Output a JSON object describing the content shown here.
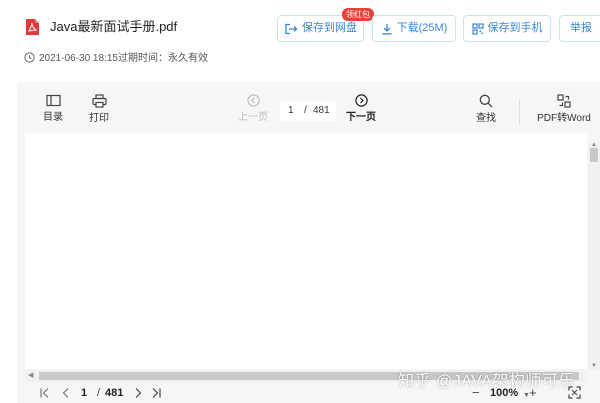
{
  "header": {
    "file_title": "Java最新面试手册.pdf",
    "meta_text": "2021-06-30 18:15过期时间：永久有效",
    "buttons": {
      "save_disk": "保存到网盘",
      "save_disk_badge": "领红包",
      "download": "下载(25M)",
      "save_phone": "保存到手机",
      "report": "举报"
    },
    "colors": {
      "accent": "#3a86d9",
      "badge": "#e9423a",
      "pdf_icon": "#e3393c"
    }
  },
  "toolbar": {
    "catalog_label": "目录",
    "print_label": "打印",
    "prev_label": "上一页",
    "current_page": "1",
    "slash": "/",
    "total_pages": "481",
    "next_label": "下一页",
    "search_label": "查找",
    "to_word_label": "PDF转Word"
  },
  "bottombar": {
    "current_page": "1",
    "slash": "/",
    "total_pages": "481",
    "zoom_minus": "−",
    "zoom_value": "100%",
    "zoom_plus": "+"
  },
  "watermark": {
    "text": "知乎 @JAVA架构师可乐"
  }
}
